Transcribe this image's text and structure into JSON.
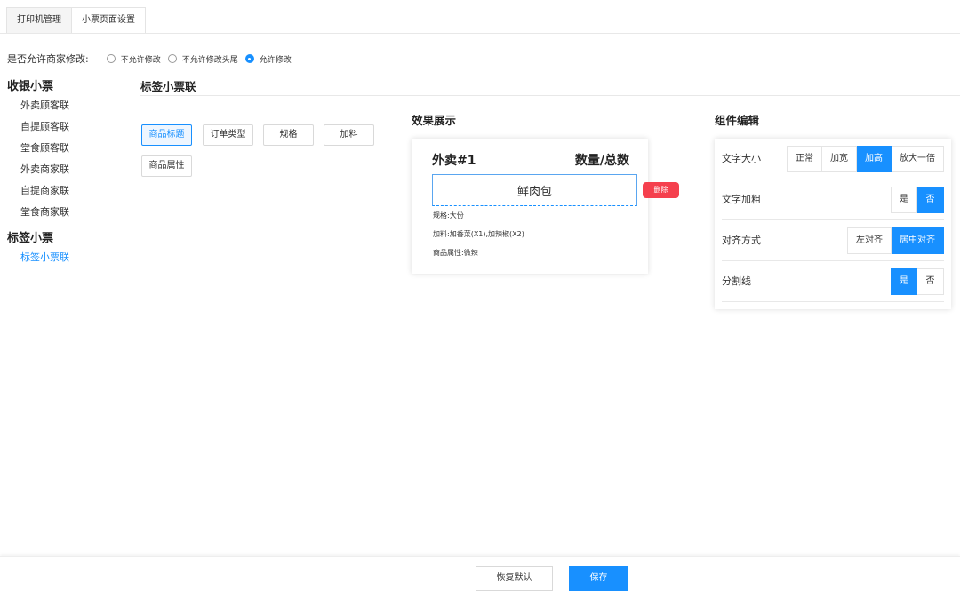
{
  "tabs": [
    {
      "label": "打印机管理",
      "active": false
    },
    {
      "label": "小票页面设置",
      "active": true
    }
  ],
  "permission": {
    "label": "是否允许商家修改:",
    "options": [
      {
        "label": "不允许修改",
        "checked": false
      },
      {
        "label": "不允许修改头尾",
        "checked": false
      },
      {
        "label": "允许修改",
        "checked": true
      }
    ]
  },
  "sidebar": {
    "groups": [
      {
        "title": "收银小票",
        "items": [
          "外卖顾客联",
          "自提顾客联",
          "堂食顾客联",
          "外卖商家联",
          "自提商家联",
          "堂食商家联"
        ]
      },
      {
        "title": "标签小票",
        "items": [
          "标签小票联"
        ]
      }
    ],
    "active_item": "标签小票联"
  },
  "main": {
    "title": "标签小票联",
    "components": [
      {
        "label": "商品标题",
        "selected": true
      },
      {
        "label": "订单类型",
        "selected": false
      },
      {
        "label": "规格",
        "selected": false
      },
      {
        "label": "加料",
        "selected": false
      },
      {
        "label": "商品属性",
        "selected": false
      }
    ]
  },
  "preview": {
    "title": "效果展示",
    "header_left": "外卖#1",
    "header_right": "数量/总数",
    "product_name": "鲜肉包",
    "spec": "规格:大份",
    "addons": "加料:加香菜(X1),加辣椒(X2)",
    "attributes": "商品属性:微辣",
    "delete_label": "删除"
  },
  "editor": {
    "title": "组件编辑",
    "rows": [
      {
        "label": "文字大小",
        "options": [
          "正常",
          "加宽",
          "加高",
          "放大一倍"
        ],
        "selected": "加高"
      },
      {
        "label": "文字加粗",
        "options": [
          "是",
          "否"
        ],
        "selected": "否"
      },
      {
        "label": "对齐方式",
        "options": [
          "左对齐",
          "居中对齐"
        ],
        "selected": "居中对齐"
      },
      {
        "label": "分割线",
        "options": [
          "是",
          "否"
        ],
        "selected": "是"
      }
    ]
  },
  "footer": {
    "reset_label": "恢复默认",
    "save_label": "保存"
  },
  "colors": {
    "accent": "#1890ff",
    "danger": "#f5404e"
  }
}
